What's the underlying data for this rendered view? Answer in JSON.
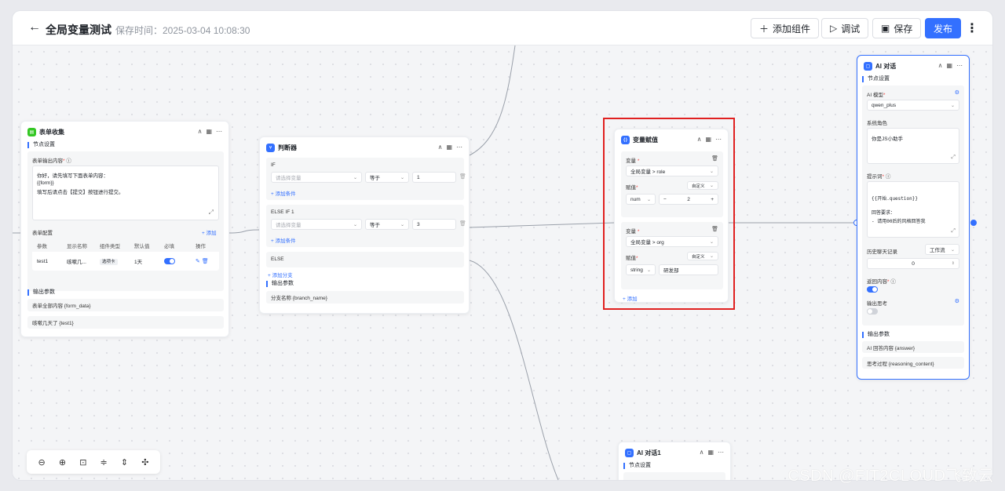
{
  "header": {
    "title": "全局变量测试",
    "save_time": "保存时间：2025-03-04 10:08:30",
    "add_component": "添加组件",
    "debug": "调试",
    "save": "保存",
    "publish": "发布",
    "accent": "#3370ff"
  },
  "form_node": {
    "title": "表单收集",
    "settings": "节点设置",
    "output_content_label": "表单输出内容",
    "output_content_lines": [
      "你好，请先填写下面表单内容：",
      "{{form}}",
      "填写后请点击【提交】按钮进行提交。"
    ],
    "config_label": "表单配置",
    "add": "+ 添加",
    "columns": [
      "参数",
      "显示名称",
      "组件类型",
      "默认值",
      "必填",
      "操作"
    ],
    "row": {
      "param": "test1",
      "display": "咳嗽几...",
      "type": "选项卡",
      "default": "1天"
    },
    "output_params": "输出参数",
    "outputs": [
      "表单全部内容 {form_data}",
      "咳嗽几天了 {test1}"
    ]
  },
  "judge_node": {
    "title": "判断器",
    "if": "IF",
    "else_if": "ELSE IF 1",
    "else": "ELSE",
    "var_placeholder": "请选择变量",
    "op": "等于",
    "val1": "1",
    "val2": "3",
    "add_condition": "+ 添加条件",
    "add_branch": "+ 添加分支",
    "output_params": "输出参数",
    "output": "分支名称 {branch_name}"
  },
  "assign_node": {
    "title": "变量赋值",
    "highlight_color": "#e02020",
    "var_label": "变量",
    "assign_label": "赋值",
    "mode": "自定义",
    "items": [
      {
        "var": "全局变量 > role",
        "type": "num",
        "value": "2"
      },
      {
        "var": "全局变量 > org",
        "type": "string",
        "value": "研发部"
      }
    ],
    "add": "+ 添加"
  },
  "ai_node": {
    "title": "AI 对话",
    "settings": "节点设置",
    "model_label": "AI 模型",
    "model": "qwen_plus",
    "role_label": "系统角色",
    "role": "你是JS小助手",
    "prompt_label": "提示词",
    "prompt_lines": [
      "{{开始.question}}",
      "",
      "回答要求：",
      "- 请用00后的风格回答我"
    ],
    "history_label": "历史聊天记录",
    "history_mode": "工作流",
    "history_count": "0",
    "return_label": "返回内容",
    "think_label": "输出思考",
    "output_params": "输出参数",
    "outputs": [
      "AI 回答内容 {answer}",
      "思考过程 {reasoning_content}"
    ]
  },
  "ai_node2": {
    "title": "AI 对话1",
    "settings": "节点设置"
  },
  "watermark": "CSDN @FIT2CLOUD飞致云"
}
